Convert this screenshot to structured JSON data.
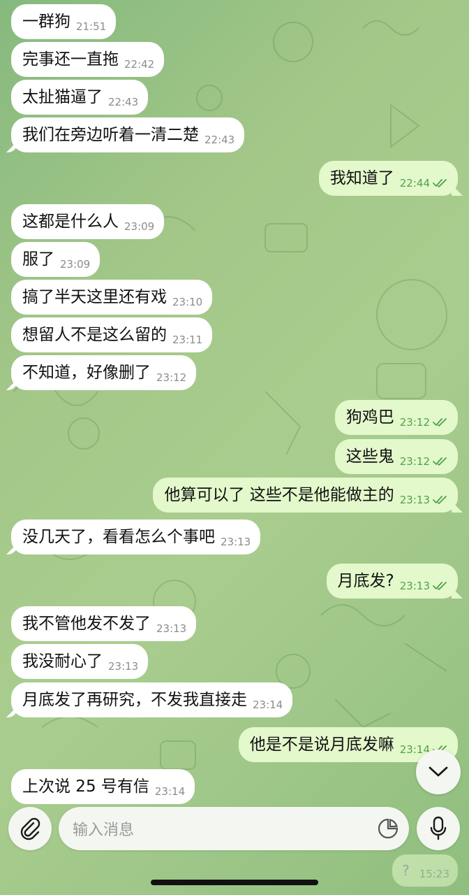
{
  "colors": {
    "incoming_bubble": "#ffffff",
    "outgoing_bubble": "#e3f8cb",
    "outgoing_time": "#4fa34b",
    "incoming_time": "#8c8c8c",
    "wallpaper": "#a3c788"
  },
  "messages": [
    {
      "dir": "in",
      "text": "一群狗",
      "time": "21:51"
    },
    {
      "dir": "in",
      "text": "完事还一直拖",
      "time": "22:42"
    },
    {
      "dir": "in",
      "text": "太扯猫逼了",
      "time": "22:43"
    },
    {
      "dir": "in",
      "text": "我们在旁边听着一清二楚",
      "time": "22:43"
    },
    {
      "dir": "out",
      "text": "我知道了",
      "time": "22:44"
    },
    {
      "dir": "in",
      "text": "这都是什么人",
      "time": "23:09"
    },
    {
      "dir": "in",
      "text": "服了",
      "time": "23:09"
    },
    {
      "dir": "in",
      "text": "搞了半天这里还有戏",
      "time": "23:10"
    },
    {
      "dir": "in",
      "text": "想留人不是这么留的",
      "time": "23:11"
    },
    {
      "dir": "in",
      "text": "不知道，好像删了",
      "time": "23:12"
    },
    {
      "dir": "out",
      "text": "狗鸡巴",
      "time": "23:12"
    },
    {
      "dir": "out",
      "text": "这些鬼",
      "time": "23:12"
    },
    {
      "dir": "out",
      "text": "他算可以了 这些不是他能做主的",
      "time": "23:13"
    },
    {
      "dir": "in",
      "text": "没几天了，看看怎么个事吧",
      "time": "23:13"
    },
    {
      "dir": "out",
      "text": "月底发?",
      "time": "23:13"
    },
    {
      "dir": "in",
      "text": "我不管他发不发了",
      "time": "23:13"
    },
    {
      "dir": "in",
      "text": "我没耐心了",
      "time": "23:13"
    },
    {
      "dir": "in",
      "text": "月底发了再研究，不发我直接走",
      "time": "23:14"
    },
    {
      "dir": "out",
      "text": "他是不是说月底发嘛",
      "time": "23:14"
    },
    {
      "dir": "in",
      "text": "上次说 25 号有信",
      "time": "23:14"
    }
  ],
  "composer": {
    "placeholder": "输入消息",
    "attach_icon": "paperclip-icon",
    "sticker_icon": "sticker-icon",
    "mic_icon": "microphone-icon"
  },
  "scroll_button": {
    "icon": "chevron-down-icon"
  },
  "partial_message": {
    "text": "?",
    "time": "15:23"
  }
}
